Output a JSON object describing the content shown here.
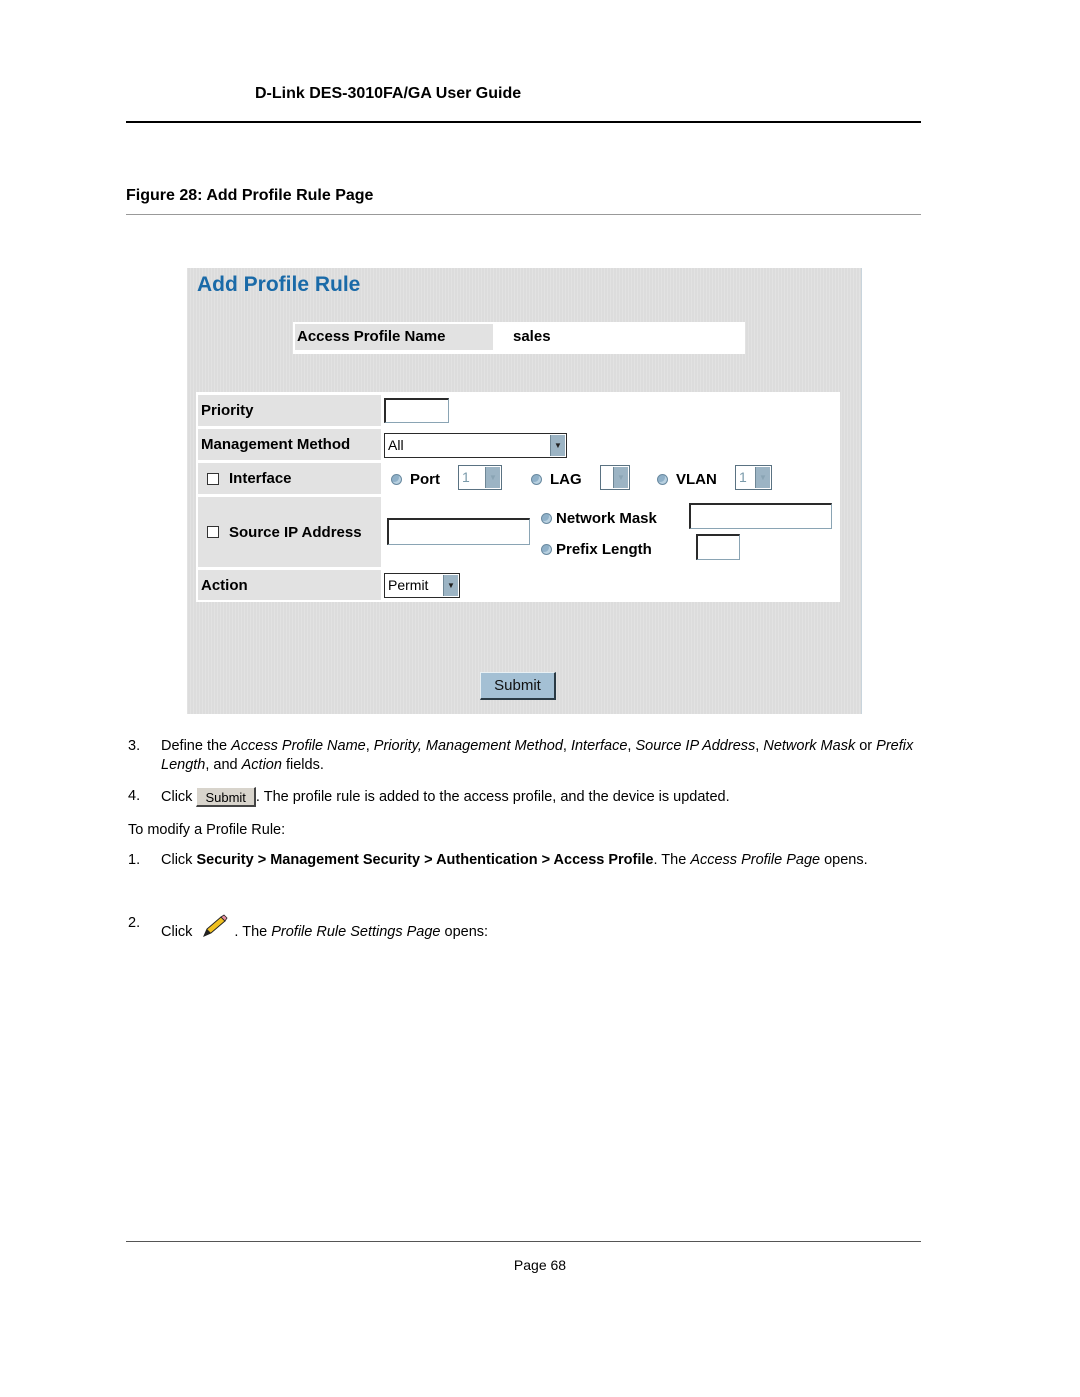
{
  "document": {
    "header_title": "D-Link DES-3010FA/GA User Guide",
    "figure_caption": "Figure 28:  Add Profile Rule Page",
    "page_label": "Page 68"
  },
  "screenshot": {
    "title": "Add Profile Rule",
    "access_profile_name_label": "Access Profile Name",
    "access_profile_name_value": "sales",
    "fields": {
      "priority": {
        "label": "Priority",
        "value": ""
      },
      "management_method": {
        "label": "Management Method",
        "selected": "All"
      },
      "interface": {
        "label": "Interface",
        "checked": false,
        "port": {
          "label": "Port",
          "selected": "1"
        },
        "lag": {
          "label": "LAG",
          "selected": ""
        },
        "vlan": {
          "label": "VLAN",
          "selected": "1"
        }
      },
      "source_ip": {
        "label": "Source IP Address",
        "checked": false,
        "value": "",
        "network_mask": {
          "label": "Network Mask",
          "value": ""
        },
        "prefix_length": {
          "label": "Prefix Length",
          "value": ""
        }
      },
      "action": {
        "label": "Action",
        "selected": "Permit"
      }
    },
    "submit_label": "Submit",
    "colors": {
      "title": "#1a6aa8",
      "panel_bg": "#dcdcdc",
      "button_bg": "#a4c0d4"
    }
  },
  "steps": [
    {
      "number": "3.",
      "parts": [
        {
          "t": "Define the "
        },
        {
          "i": "Access Profile Name"
        },
        {
          "t": ", "
        },
        {
          "i": "Priority, Management Method"
        },
        {
          "t": ", "
        },
        {
          "i": "Interface"
        },
        {
          "t": ", "
        },
        {
          "i": "Source IP Address"
        },
        {
          "t": ", "
        },
        {
          "i": "Network Mask"
        },
        {
          "t": " or "
        },
        {
          "i": "Prefix Length"
        },
        {
          "t": ", and "
        },
        {
          "i": "Action"
        },
        {
          "t": " fields."
        }
      ]
    },
    {
      "number": "4.",
      "click": "Click",
      "button_label": "Submit",
      "after": ". The profile rule is added to the access profile, and the device is updated."
    }
  ],
  "modify_intro": "To modify a Profile Rule:",
  "modify_steps": [
    {
      "number": "1.",
      "parts": [
        {
          "t": "Click "
        },
        {
          "b": "Security > Management Security > Authentication > Access Profile"
        },
        {
          "t": ". The "
        },
        {
          "i": "Access Profile Page"
        },
        {
          "t": " opens."
        }
      ]
    },
    {
      "number": "2.",
      "click": "Click",
      "icon": "pencil-edit-icon",
      "after_pre": ". The ",
      "after_italic": "Profile Rule Settings Page",
      "after_post": " opens:"
    }
  ]
}
